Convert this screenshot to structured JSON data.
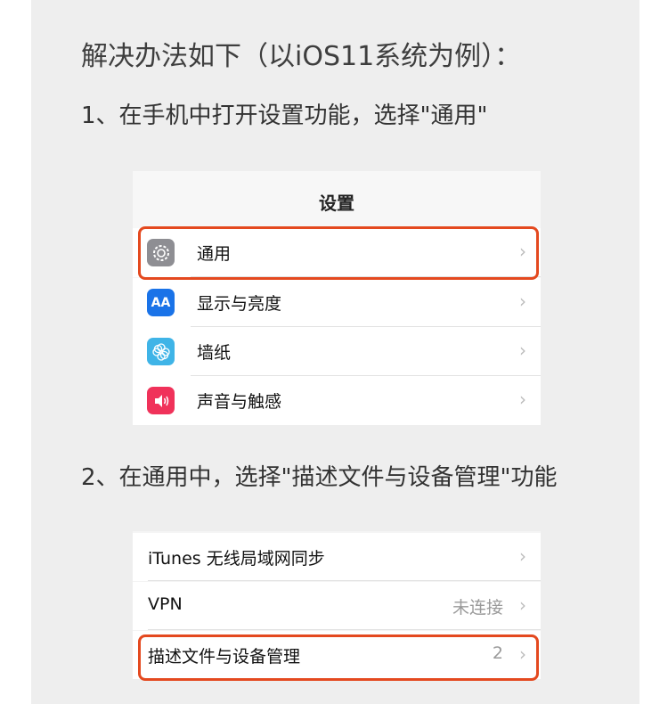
{
  "heading": "解决办法如下（以iOS11系统为例）：",
  "step1": "1、在手机中打开设置功能，选择\"通用\"",
  "step2": "2、在通用中，选择\"描述文件与设备管理\"功能",
  "settings_screen": {
    "title": "设置",
    "items": [
      {
        "label": "通用",
        "icon": "gear-icon",
        "color": "#8e8e93"
      },
      {
        "label": "显示与亮度",
        "icon": "text-size-icon",
        "color": "#1a73e8"
      },
      {
        "label": "墙纸",
        "icon": "flower-icon",
        "color": "#3fb4e7"
      },
      {
        "label": "声音与触感",
        "icon": "speaker-icon",
        "color": "#f0325a"
      }
    ]
  },
  "general_screen": {
    "items": [
      {
        "label": "iTunes 无线局域网同步",
        "value": ""
      },
      {
        "label": "VPN",
        "value": "未连接"
      },
      {
        "label": "描述文件与设备管理",
        "value": "2"
      }
    ]
  },
  "icon_texts": {
    "display": "AA"
  },
  "chevron": "›",
  "colors": {
    "highlight": "#e4491f"
  }
}
